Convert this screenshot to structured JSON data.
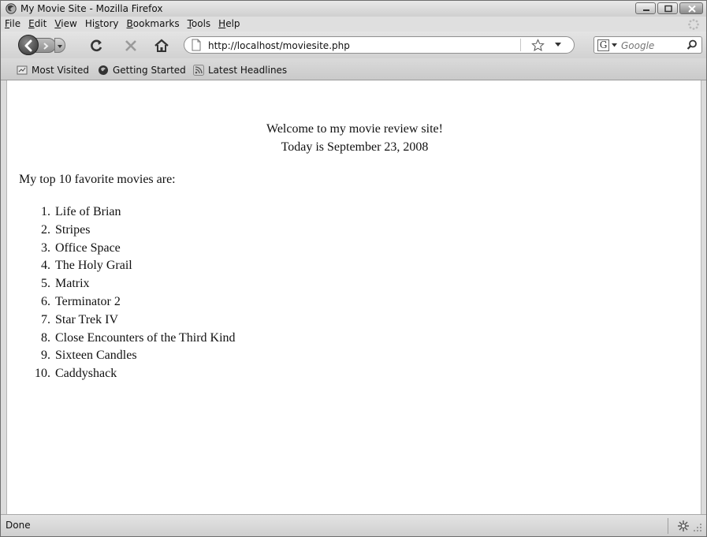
{
  "window": {
    "title": "My Movie Site - Mozilla Firefox"
  },
  "menu": {
    "items": [
      {
        "accel": "F",
        "rest": "ile"
      },
      {
        "accel": "E",
        "rest": "dit"
      },
      {
        "accel": "V",
        "rest": "iew"
      },
      {
        "pre": "Hi",
        "accel": "s",
        "rest": "tory"
      },
      {
        "accel": "B",
        "rest": "ookmarks"
      },
      {
        "accel": "T",
        "rest": "ools"
      },
      {
        "accel": "H",
        "rest": "elp"
      }
    ]
  },
  "toolbar": {
    "url": "http://localhost/moviesite.php",
    "search_placeholder": "Google",
    "search_engine_letter": "G"
  },
  "bookmarks": {
    "items": [
      "Most Visited",
      "Getting Started",
      "Latest Headlines"
    ]
  },
  "page": {
    "welcome": "Welcome to my movie review site!",
    "date_line": "Today is September 23, 2008",
    "intro": "My top 10 favorite movies are:",
    "movies": [
      {
        "num": "1.",
        "title": "Life of Brian"
      },
      {
        "num": "2.",
        "title": "Stripes"
      },
      {
        "num": "3.",
        "title": "Office Space"
      },
      {
        "num": "4.",
        "title": "The Holy Grail"
      },
      {
        "num": "5.",
        "title": "Matrix"
      },
      {
        "num": "6.",
        "title": "Terminator 2"
      },
      {
        "num": "7.",
        "title": "Star Trek IV"
      },
      {
        "num": "8.",
        "title": "Close Encounters of the Third Kind"
      },
      {
        "num": "9.",
        "title": "Sixteen Candles"
      },
      {
        "num": "10.",
        "title": "Caddyshack"
      }
    ]
  },
  "status": {
    "text": "Done"
  },
  "icons": {
    "app": "firefox-icon",
    "back": "back-arrow-icon",
    "forward": "forward-arrow-icon",
    "reload": "reload-icon",
    "stop": "stop-icon",
    "home": "home-icon",
    "page": "page-icon",
    "star": "bookmark-star-icon",
    "search": "magnifier-icon"
  }
}
